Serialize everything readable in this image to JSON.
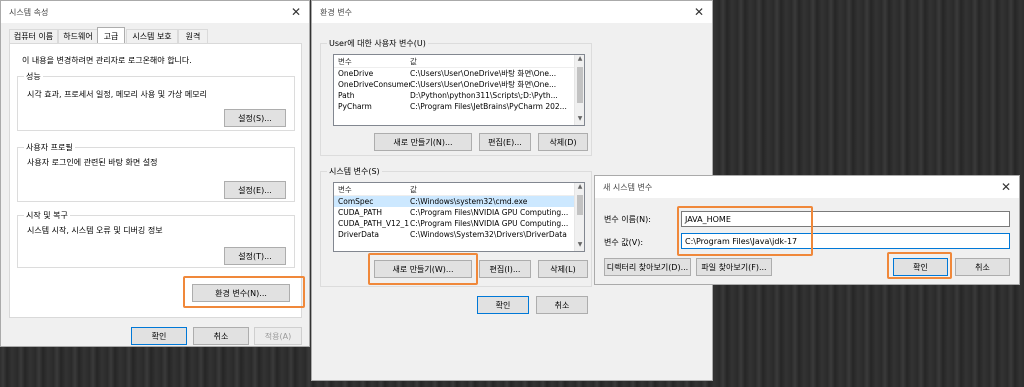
{
  "sysprops": {
    "title": "시스템 속성",
    "tabs": [
      "컴퓨터 이름",
      "하드웨어",
      "고급",
      "시스템 보호",
      "원격"
    ],
    "intro": "이 내용을 변경하려면 관리자로 로그온해야 합니다.",
    "performance": {
      "label": "성능",
      "desc": "시각 효과, 프로세서 일정, 메모리 사용 및 가상 메모리",
      "button": "설정(S)..."
    },
    "profile": {
      "label": "사용자 프로필",
      "desc": "사용자 로그인에 관련된 바탕 화면 설정",
      "button": "설정(E)..."
    },
    "startup": {
      "label": "시작 및 복구",
      "desc": "시스템 시작, 시스템 오류 및 디버깅 정보",
      "button": "설정(T)..."
    },
    "env_button": "환경 변수(N)...",
    "ok": "확인",
    "cancel": "취소",
    "apply": "적용(A)"
  },
  "envvars": {
    "title": "환경 변수",
    "user_group": "User에 대한 사용자 변수(U)",
    "col_var": "변수",
    "col_val": "값",
    "user_rows": [
      {
        "name": "OneDrive",
        "value": "C:\\Users\\User\\OneDrive\\바탕 화면\\One..."
      },
      {
        "name": "OneDriveConsumer",
        "value": "C:\\Users\\User\\OneDrive\\바탕 화면\\One..."
      },
      {
        "name": "Path",
        "value": "D:\\Python\\python311\\Scripts\\;D:\\Pyth..."
      },
      {
        "name": "PyCharm",
        "value": "C:\\Program Files\\JetBrains\\PyCharm 202..."
      }
    ],
    "user_new": "새로 만들기(N)...",
    "user_edit": "편집(E)...",
    "user_delete": "삭제(D)",
    "sys_group": "시스템 변수(S)",
    "sys_rows": [
      {
        "name": "ComSpec",
        "value": "C:\\Windows\\system32\\cmd.exe"
      },
      {
        "name": "CUDA_PATH",
        "value": "C:\\Program Files\\NVIDIA GPU Computing..."
      },
      {
        "name": "CUDA_PATH_V12_1",
        "value": "C:\\Program Files\\NVIDIA GPU Computing..."
      },
      {
        "name": "DriverData",
        "value": "C:\\Windows\\System32\\Drivers\\DriverData"
      }
    ],
    "sys_new": "새로 만들기(W)...",
    "sys_edit": "편집(I)...",
    "sys_delete": "삭제(L)",
    "ok": "확인",
    "cancel": "취소"
  },
  "newvar": {
    "title": "새 시스템 변수",
    "name_label": "변수 이름(N):",
    "name_value": "JAVA_HOME",
    "value_label": "변수 값(V):",
    "value_value": "C:\\Program Files\\Java\\jdk-17",
    "browse_dir": "디렉터리 찾아보기(D)...",
    "browse_file": "파일 찾아보기(F)...",
    "ok": "확인",
    "cancel": "취소"
  },
  "colors": {
    "highlight": "#f0883a",
    "selection": "#cce8ff",
    "focus": "#0078d7"
  }
}
